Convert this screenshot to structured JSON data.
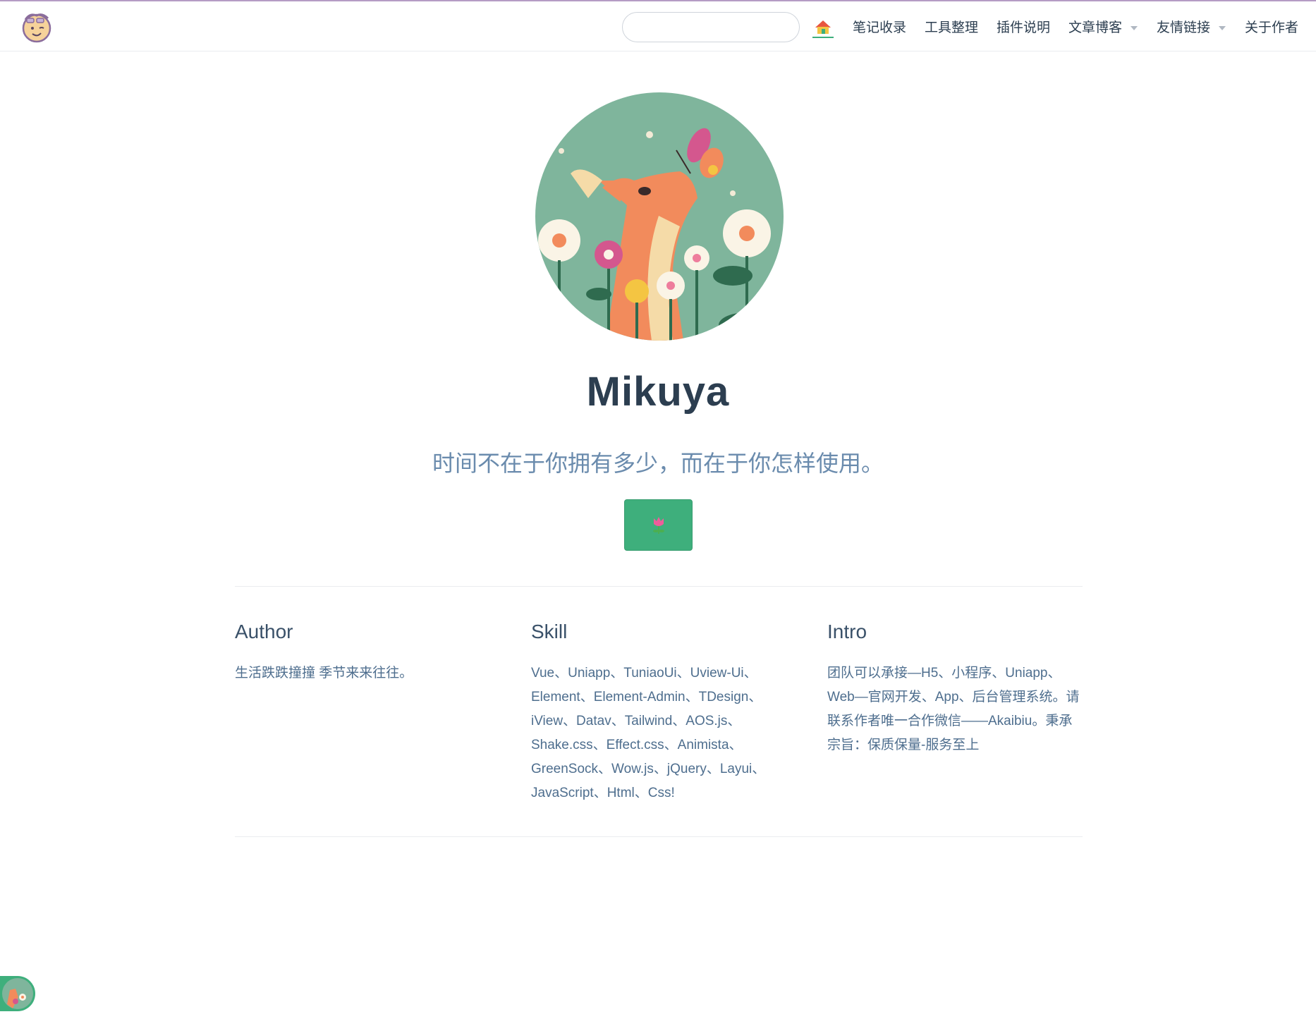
{
  "header": {
    "search_placeholder": "",
    "nav": [
      {
        "label": "笔记收录",
        "dropdown": false
      },
      {
        "label": "工具整理",
        "dropdown": false
      },
      {
        "label": "插件说明",
        "dropdown": false
      },
      {
        "label": "文章博客",
        "dropdown": true
      },
      {
        "label": "友情链接",
        "dropdown": true
      },
      {
        "label": "关于作者",
        "dropdown": false
      }
    ],
    "home_icon": "house-icon",
    "logo_icon": "smiley-face-logo-icon"
  },
  "hero": {
    "image_icon": "deer-butterfly-illustration",
    "title": "Mikuya",
    "description": "时间不在于你拥有多少，而在于你怎样使用。",
    "action_icon": "tulip-icon",
    "action_color": "#3eaf7c"
  },
  "features": [
    {
      "title": "Author",
      "details": "生活跌跌撞撞 季节来来往往。"
    },
    {
      "title": "Skill",
      "details": "Vue、Uniapp、TuniaoUi、Uview-Ui、Element、Element-Admin、TDesign、iView、Datav、Tailwind、AOS.js、Shake.css、Effect.css、Animista、GreenSock、Wow.js、jQuery、Layui、JavaScript、Html、Css!"
    },
    {
      "title": "Intro",
      "details": "团队可以承接—H5、小程序、Uniapp、Web—官网开发、App、后台管理系统。请联系作者唯一合作微信——Akaibiu。秉承宗旨：保质保量-服务至上"
    }
  ],
  "floating_button_icon": "deer-avatar-icon",
  "colors": {
    "accent": "#3eaf7c",
    "text": "#2c3e50",
    "muted": "#6a8bad"
  }
}
